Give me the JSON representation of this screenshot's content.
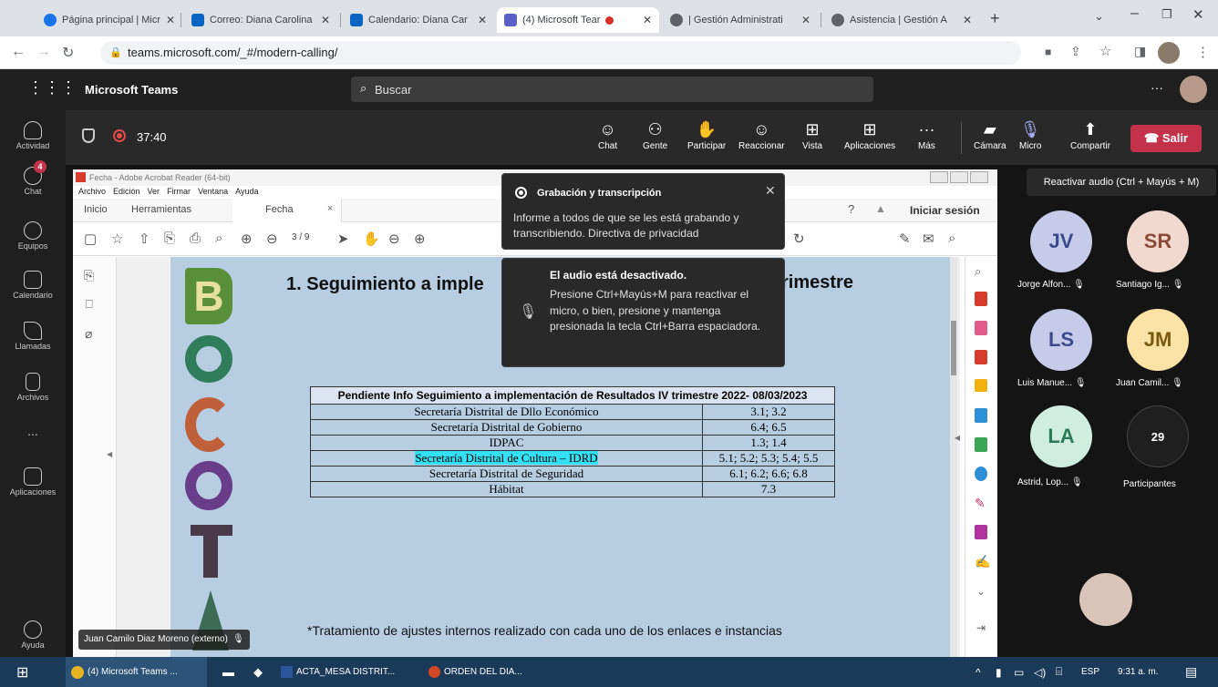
{
  "browser": {
    "tabs": [
      {
        "title": "Página principal | Micr",
        "color": "#1a73e8"
      },
      {
        "title": "Correo: Diana Carolina",
        "color": "#0a66c2"
      },
      {
        "title": "Calendario: Diana Car",
        "color": "#0a66c2"
      },
      {
        "title": "(4) Microsoft Tear",
        "color": "#5b5fc7"
      },
      {
        "title": "| Gestión Administrati",
        "color": "#555"
      },
      {
        "title": "Asistencia | Gestión A",
        "color": "#555"
      }
    ],
    "url": "teams.microsoft.com/_#/modern-calling/"
  },
  "teams": {
    "app_name": "Microsoft Teams",
    "search_placeholder": "Buscar",
    "rail": [
      {
        "label": "Actividad",
        "badge": ""
      },
      {
        "label": "Chat",
        "badge": "4"
      },
      {
        "label": "Equipos",
        "badge": ""
      },
      {
        "label": "Calendario",
        "badge": ""
      },
      {
        "label": "Llamadas",
        "badge": ""
      },
      {
        "label": "Archivos",
        "badge": ""
      },
      {
        "label": "...",
        "badge": ""
      },
      {
        "label": "Aplicaciones",
        "badge": ""
      },
      {
        "label": "Ayuda",
        "badge": ""
      }
    ],
    "call": {
      "timer": "37:40",
      "controls": [
        "Chat",
        "Gente",
        "Participar",
        "Reaccionar",
        "Vista",
        "Aplicaciones",
        "Más",
        "Cámara",
        "Micro",
        "Compartir"
      ],
      "leave": "Salir"
    }
  },
  "acrobat": {
    "title": "Fecha - Adobe Acrobat Reader (64-bit)",
    "menu": [
      "Archivo",
      "Edición",
      "Ver",
      "Firmar",
      "Ventana",
      "Ayuda"
    ],
    "tabs": [
      "Inicio",
      "Herramientas",
      "Fecha"
    ],
    "signin": "Iniciar sesión",
    "page_current": "3",
    "page_total": "/ 9"
  },
  "slide": {
    "title": "1. Seguimiento a imple",
    "title_right": "rimestre",
    "table_header": "Pendiente Info Seguimiento a implementación de Resultados IV trimestre 2022- 08/03/2023",
    "rows": [
      {
        "entity": "Secretaría Distrital de Dllo Económico",
        "value": "3.1; 3.2"
      },
      {
        "entity": "Secretaría Distrital de Gobierno",
        "value": "6.4; 6.5"
      },
      {
        "entity": "IDPAC",
        "value": "1.3; 1.4"
      },
      {
        "entity": "Secretaría Distrital de Cultura – IDRD",
        "value": "5.1; 5.2; 5.3; 5.4; 5.5"
      },
      {
        "entity": "Secretaría Distrital de Seguridad",
        "value": "6.1; 6.2; 6.6; 6.8"
      },
      {
        "entity": "Hábitat",
        "value": "7.3"
      }
    ],
    "footnote": "*Tratamiento de ajustes internos realizado con cada uno de los enlaces e instancias",
    "logo_letters": [
      "B",
      "O",
      "G",
      "O",
      "T",
      "A"
    ]
  },
  "notices": {
    "recording_title": "Grabación y transcripción",
    "recording_body": "Informe a todos de que se les está grabando y transcribiendo. Directiva de privacidad",
    "mute_title": "El audio está desactivado.",
    "mute_body": "Presione Ctrl+Mayús+M para reactivar el micro, o bien, presione y mantenga presionada la tecla Ctrl+Barra espaciadora.",
    "unmute_tip": "Reactivar audio (Ctrl + Mayús + M)"
  },
  "presenter": "Juan Camilo Diaz Moreno (externo)",
  "participants": [
    {
      "initials": "JV",
      "name": "Jorge Alfon...",
      "bg": "#c5cbe8",
      "fg": "#3b4a8c"
    },
    {
      "initials": "SR",
      "name": "Santiago Ig...",
      "bg": "#f1d9cf",
      "fg": "#8a4a36"
    },
    {
      "initials": "LS",
      "name": "Luis Manue...",
      "bg": "#c5cbe8",
      "fg": "#3b4a8c"
    },
    {
      "initials": "JM",
      "name": "Juan Camil...",
      "bg": "#fbe3a5",
      "fg": "#7a5a10"
    },
    {
      "initials": "LA",
      "name": "Astrid, Lop...",
      "bg": "#cfeee0",
      "fg": "#2c7a57"
    },
    {
      "initials": "29",
      "name": "Participantes",
      "bg": "#1f1f1f",
      "fg": "#ffffff"
    }
  ],
  "taskbar": {
    "items": [
      "(4) Microsoft Teams ...",
      "ACTA_MESA DISTRIT...",
      "ORDEN DEL DIA..."
    ],
    "lang": "ESP",
    "time": "9:31 a. m."
  }
}
